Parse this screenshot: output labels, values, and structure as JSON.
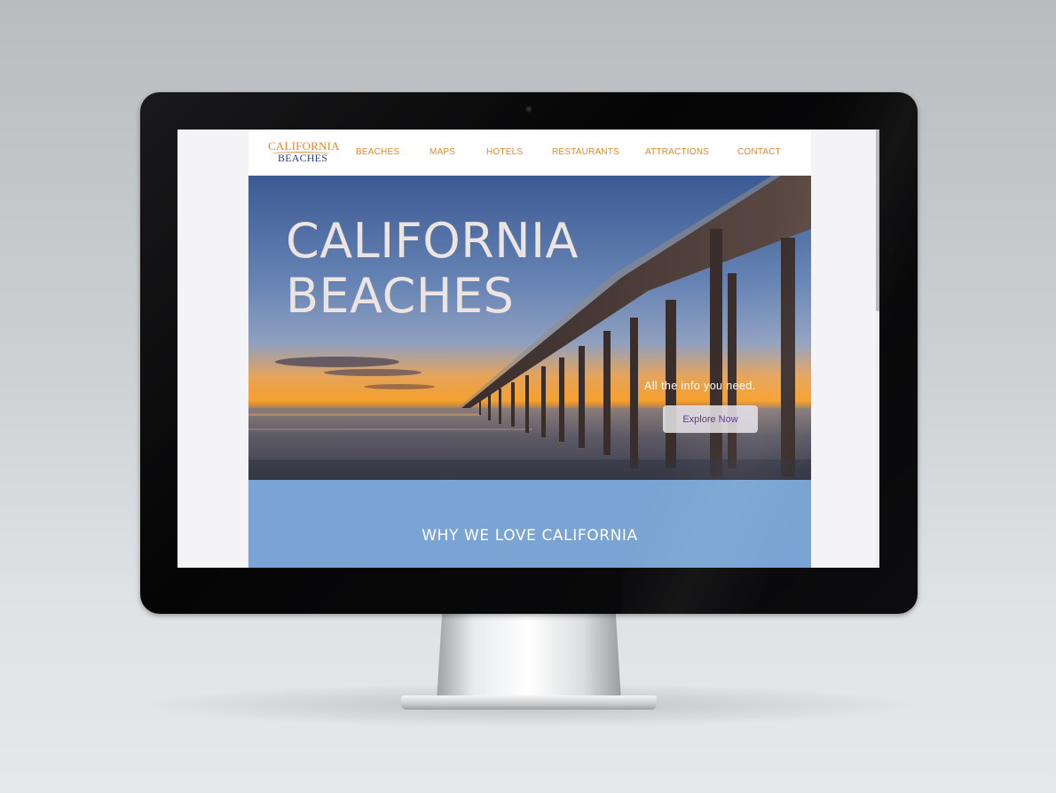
{
  "logo": {
    "top": "CALIFORNIA",
    "bottom": "BEACHES"
  },
  "nav": {
    "items": [
      "BEACHES",
      "MAPS",
      "HOTELS",
      "RESTAURANTS",
      "ATTRACTIONS",
      "CONTACT"
    ]
  },
  "hero": {
    "title_line1": "CALIFORNIA",
    "title_line2": "BEACHES",
    "tagline": "All the info you need.",
    "cta_label": "Explore Now",
    "photo_subject": "ocean pier at sunset"
  },
  "section": {
    "heading": "WHY WE LOVE CALIFORNIA"
  },
  "colors": {
    "nav_link": "#e2882c",
    "logo_orange": "#e2882c",
    "logo_blue": "#2a3f86",
    "section_bg": "#7aa4d3",
    "cta_text": "#5b3b8c",
    "bezel": "#0a0a0c"
  }
}
